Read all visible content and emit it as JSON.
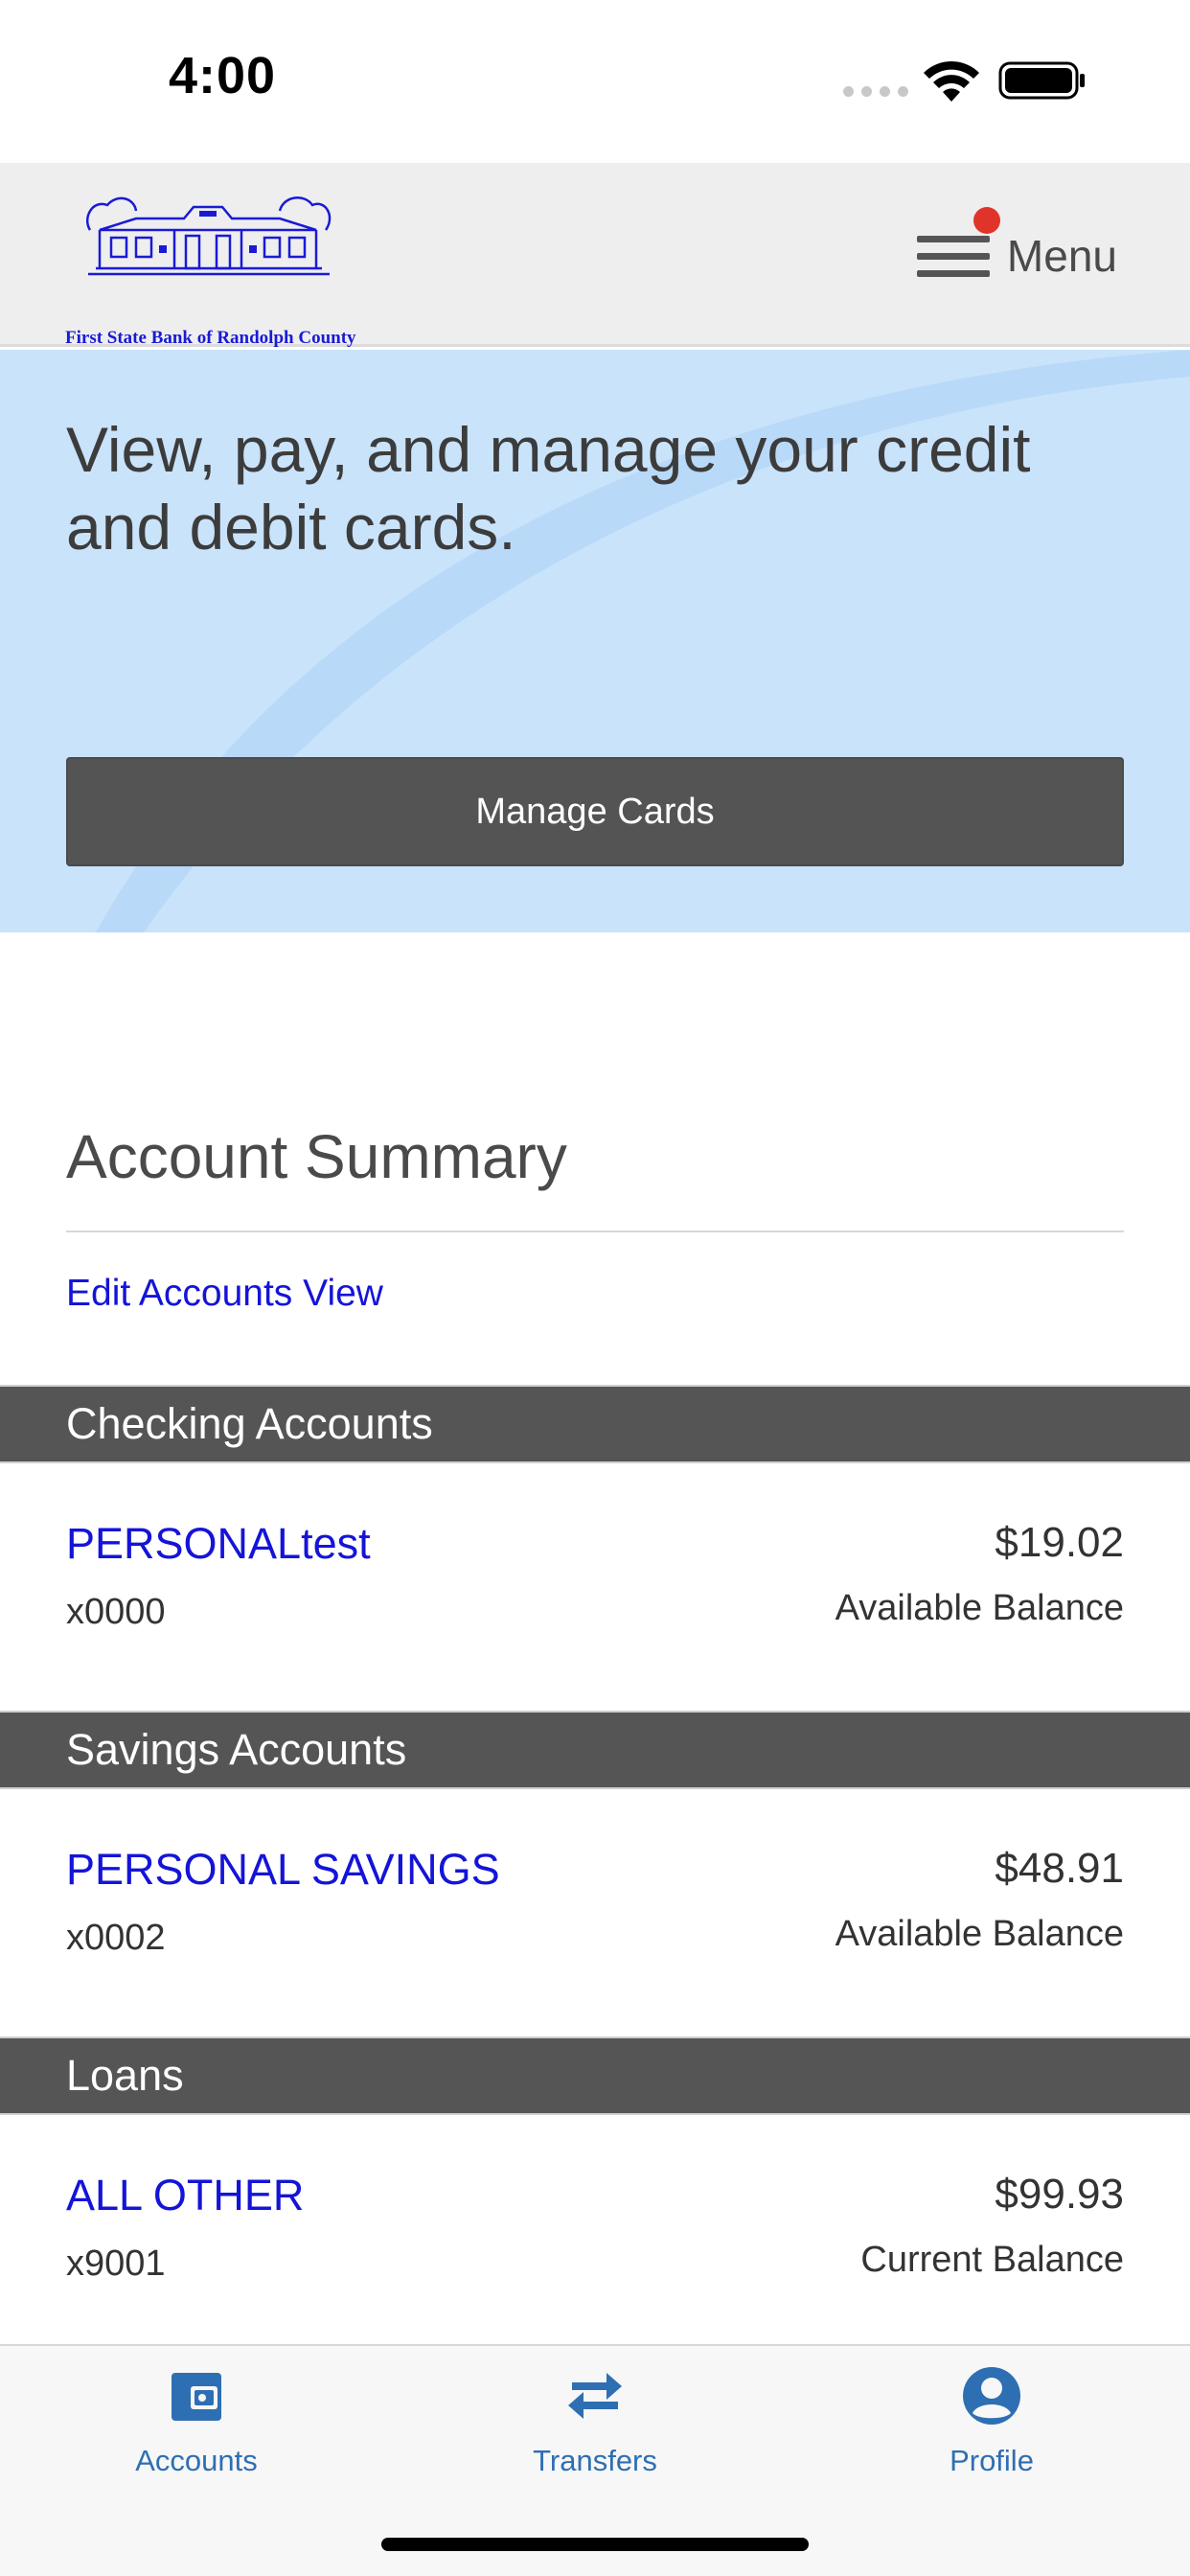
{
  "status_bar": {
    "time": "4:00"
  },
  "header": {
    "logo_caption": "First State Bank of Randolph County",
    "menu_label": "Menu"
  },
  "hero": {
    "text": "View, pay, and manage your credit and debit cards.",
    "button_label": "Manage Cards"
  },
  "summary": {
    "title": "Account Summary",
    "edit_link": "Edit Accounts View"
  },
  "sections": [
    {
      "title": "Checking Accounts",
      "accounts": [
        {
          "name": "PERSONALtest",
          "number": "x0000",
          "amount": "$19.02",
          "balance_label": "Available Balance"
        }
      ]
    },
    {
      "title": "Savings Accounts",
      "accounts": [
        {
          "name": "PERSONAL SAVINGS",
          "number": "x0002",
          "amount": "$48.91",
          "balance_label": "Available Balance"
        }
      ]
    },
    {
      "title": "Loans",
      "accounts": [
        {
          "name": "ALL OTHER",
          "number": "x9001",
          "amount": "$99.93",
          "balance_label": "Current Balance"
        }
      ]
    }
  ],
  "tabs": [
    {
      "label": "Accounts",
      "icon": "wallet-icon"
    },
    {
      "label": "Transfers",
      "icon": "transfer-arrows-icon"
    },
    {
      "label": "Profile",
      "icon": "profile-icon"
    }
  ],
  "colors": {
    "link_blue": "#1414d8",
    "tab_blue": "#2e6fb3",
    "hero_bg": "#c9e3fb",
    "section_header_bg": "#555555",
    "notification_red": "#e0342b"
  }
}
